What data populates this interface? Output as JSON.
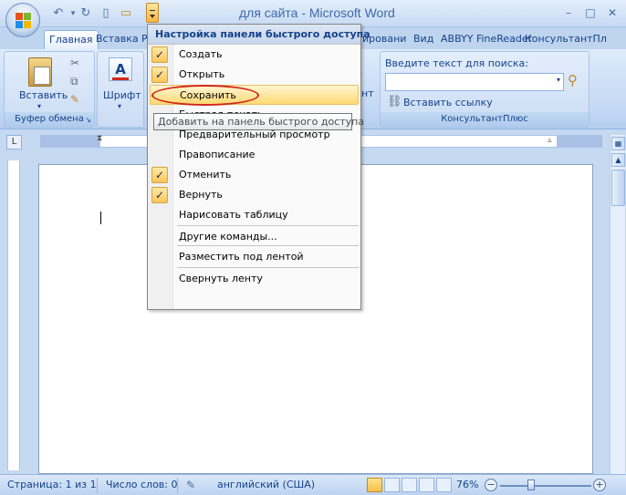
{
  "window": {
    "title": "для сайта - Microsoft Word",
    "minimize": "–",
    "maximize": "□",
    "close": "✕"
  },
  "qat": {
    "undo": "↶",
    "redo": "↻",
    "new": "▯",
    "open": "▭"
  },
  "tabs": {
    "home": "Главная",
    "insert": "Вставка",
    "p": "Р",
    "review": "ировани",
    "view": "Вид",
    "abbyy": "ABBYY FineReader",
    "consultant": "КонсультантПл"
  },
  "ribbon": {
    "paste_label": "Вставить",
    "clipboard_caption": "Буфер обмена",
    "font_label": "Шрифт",
    "styles_fragment": "нт",
    "search_label": "Введите текст для поиска:",
    "insert_link": "Вставить ссылку",
    "consultant_caption": "КонсультантПлюс"
  },
  "menu": {
    "header": "Настройка панели быстрого доступа",
    "items": [
      {
        "label": "Создать",
        "checked": true
      },
      {
        "label": "Открыть",
        "checked": true
      },
      {
        "label": "Сохранить",
        "checked": false,
        "hover": true
      },
      {
        "label": "Быстрая печать",
        "checked": false
      },
      {
        "label": "Предварительный просмотр",
        "checked": false
      },
      {
        "label": "Правописание",
        "checked": false
      },
      {
        "label": "Отменить",
        "checked": true
      },
      {
        "label": "Вернуть",
        "checked": true
      },
      {
        "label": "Нарисовать таблицу",
        "checked": false
      },
      {
        "label": "Другие команды...",
        "checked": false
      },
      {
        "label": "Разместить под лентой",
        "checked": false
      },
      {
        "label": "Свернуть ленту",
        "checked": false
      }
    ],
    "check_glyph": "✓"
  },
  "tooltip": "Добавить на панель быстрого доступа",
  "status": {
    "page": "Страница: 1 из 1",
    "words": "Число слов: 0",
    "language": "английский (США)",
    "zoom": "76%",
    "zoom_minus": "−",
    "zoom_plus": "+"
  },
  "ruler": {
    "corner": "L"
  },
  "colors": {
    "accent": "#15428b",
    "highlight": "#ffd974",
    "circle": "#d3261c"
  }
}
